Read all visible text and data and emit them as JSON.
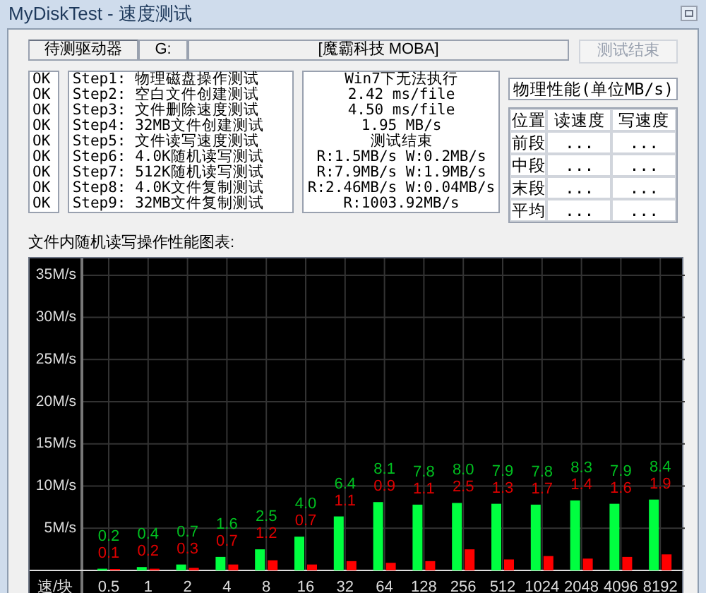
{
  "window": {
    "title": "MyDiskTest - 速度测试"
  },
  "drive_bar": {
    "label": "待测驱动器",
    "drive": "G:",
    "volume": "[魔霸科技 MOBA]"
  },
  "stop_button": {
    "label": "测试结束",
    "disabled": true
  },
  "steps": [
    {
      "status": "OK",
      "name": "Step1: 物理磁盘操作测试",
      "result": "Win7下无法执行"
    },
    {
      "status": "OK",
      "name": "Step2: 空白文件创建测试",
      "result": "2.42 ms/file"
    },
    {
      "status": "OK",
      "name": "Step3: 文件删除速度测试",
      "result": "4.50 ms/file"
    },
    {
      "status": "OK",
      "name": "Step4: 32MB文件创建测试",
      "result": "1.95 MB/s"
    },
    {
      "status": "OK",
      "name": "Step5: 文件读写速度测试",
      "result": "测试结束"
    },
    {
      "status": "OK",
      "name": "Step6: 4.0K随机读写测试",
      "result": "R:1.5MB/s W:0.2MB/s"
    },
    {
      "status": "OK",
      "name": "Step7: 512K随机读写测试",
      "result": "R:7.9MB/s W:1.9MB/s"
    },
    {
      "status": "OK",
      "name": "Step8: 4.0K文件复制测试",
      "result": "R:2.46MB/s W:0.04MB/s"
    },
    {
      "status": "OK",
      "name": "Step9: 32MB文件复制测试",
      "result": "R:1003.92MB/s"
    }
  ],
  "physical": {
    "title": "物理性能(单位MB/s)",
    "columns": [
      "位置",
      "读速度",
      "写速度"
    ],
    "rows": [
      [
        "前段",
        "...",
        "..."
      ],
      [
        "中段",
        "...",
        "..."
      ],
      [
        "末段",
        "...",
        "..."
      ],
      [
        "平均",
        "...",
        "..."
      ]
    ]
  },
  "chart": {
    "caption": "文件内随机读写操作性能图表:",
    "chart_data": {
      "type": "bar",
      "xlabel": "速/块",
      "categories": [
        "0.5",
        "1",
        "2",
        "4",
        "8",
        "16",
        "32",
        "64",
        "128",
        "256",
        "512",
        "1024",
        "2048",
        "4096",
        "8192"
      ],
      "series": [
        {
          "color": "#00ff40",
          "values": [
            0.2,
            0.4,
            0.7,
            1.6,
            2.5,
            4.0,
            6.4,
            8.1,
            7.8,
            8.0,
            7.9,
            7.8,
            8.3,
            7.9,
            8.4
          ]
        },
        {
          "color": "#ff0000",
          "values": [
            0.1,
            0.2,
            0.3,
            0.7,
            1.2,
            0.7,
            1.1,
            0.9,
            1.1,
            2.5,
            1.3,
            1.7,
            1.4,
            1.6,
            1.9
          ]
        }
      ],
      "ylim": [
        0,
        37
      ],
      "grid": true,
      "yticks": [
        {
          "value": 5,
          "label": "5M/s"
        },
        {
          "value": 10,
          "label": "10M/s"
        },
        {
          "value": 15,
          "label": "15M/s"
        },
        {
          "value": 20,
          "label": "20M/s"
        },
        {
          "value": 25,
          "label": "25M/s"
        },
        {
          "value": 30,
          "label": "30M/s"
        },
        {
          "value": 35,
          "label": "35M/s"
        }
      ],
      "value_labels": [
        [
          "0.2",
          "0.4",
          "0.7",
          "1.6",
          "2.5",
          "4.0",
          "6.4",
          "8.1",
          "7.8",
          "8.0",
          "7.9",
          "7.8",
          "8.3",
          "7.9",
          "8.4"
        ],
        [
          "0.1",
          "0.2",
          "0.3",
          "0.7",
          "1.2",
          "0.7",
          "1.1",
          "0.9",
          "1.1",
          "2.5",
          "1.3",
          "1.7",
          "1.4",
          "1.6",
          "1.9"
        ]
      ]
    }
  }
}
